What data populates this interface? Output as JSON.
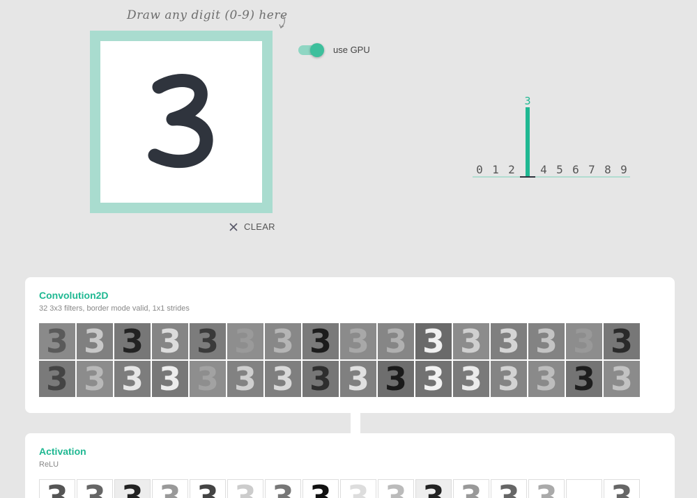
{
  "drawing": {
    "hint": "Draw any digit (0-9) here",
    "digit": "3",
    "clear_label": "CLEAR"
  },
  "gpu": {
    "label": "use GPU",
    "enabled": true
  },
  "output": {
    "labels": [
      "0",
      "1",
      "2",
      "3",
      "4",
      "5",
      "6",
      "7",
      "8",
      "9"
    ],
    "probabilities": [
      0,
      0,
      0,
      1,
      0,
      0,
      0,
      0,
      0,
      0
    ],
    "predicted": "3",
    "accent": "#1fb892"
  },
  "layers": [
    {
      "title": "Convolution2D",
      "description": "32 3x3 filters, border mode valid, 1x1 strides",
      "maps": [
        {
          "bg": "#8a8a8a",
          "fg": "#5a5a5a"
        },
        {
          "bg": "#808080",
          "fg": "#c8c8c8"
        },
        {
          "bg": "#777",
          "fg": "#222"
        },
        {
          "bg": "#858585",
          "fg": "#dcdcdc"
        },
        {
          "bg": "#7c7c7c",
          "fg": "#3a3a3a"
        },
        {
          "bg": "#8e8e8e",
          "fg": "#9a9a9a"
        },
        {
          "bg": "#888",
          "fg": "#b5b5b5"
        },
        {
          "bg": "#7a7a7a",
          "fg": "#1c1c1c"
        },
        {
          "bg": "#8b8b8b",
          "fg": "#a8a8a8"
        },
        {
          "bg": "#868686",
          "fg": "#b0b0b0"
        },
        {
          "bg": "#6a6a6a",
          "fg": "#f0f0f0"
        },
        {
          "bg": "#8c8c8c",
          "fg": "#cfcfcf"
        },
        {
          "bg": "#7f7f7f",
          "fg": "#d5d5d5"
        },
        {
          "bg": "#838383",
          "fg": "#c4c4c4"
        },
        {
          "bg": "#8d8d8d",
          "fg": "#999"
        },
        {
          "bg": "#777",
          "fg": "#2a2a2a"
        },
        {
          "bg": "#7a7a7a",
          "fg": "#444"
        },
        {
          "bg": "#8c8c8c",
          "fg": "#b8b8b8"
        },
        {
          "bg": "#7d7d7d",
          "fg": "#e6e6e6"
        },
        {
          "bg": "#787878",
          "fg": "#ededed"
        },
        {
          "bg": "#8e8e8e",
          "fg": "#a2a2a2"
        },
        {
          "bg": "#828282",
          "fg": "#cfcfcf"
        },
        {
          "bg": "#7f7f7f",
          "fg": "#d9d9d9"
        },
        {
          "bg": "#767676",
          "fg": "#2e2e2e"
        },
        {
          "bg": "#808080",
          "fg": "#e0e0e0"
        },
        {
          "bg": "#6e6e6e",
          "fg": "#1a1a1a"
        },
        {
          "bg": "#727272",
          "fg": "#f2f2f2"
        },
        {
          "bg": "#7a7a7a",
          "fg": "#ebebeb"
        },
        {
          "bg": "#848484",
          "fg": "#d2d2d2"
        },
        {
          "bg": "#8a8a8a",
          "fg": "#bdbdbd"
        },
        {
          "bg": "#747474",
          "fg": "#1e1e1e"
        },
        {
          "bg": "#8b8b8b",
          "fg": "#c2c2c2"
        }
      ]
    },
    {
      "title": "Activation",
      "description": "ReLU",
      "maps": [
        {
          "bg": "#ffffff",
          "fg": "#555"
        },
        {
          "bg": "#ffffff",
          "fg": "#666"
        },
        {
          "bg": "#ededed",
          "fg": "#222"
        },
        {
          "bg": "#ffffff",
          "fg": "#999"
        },
        {
          "bg": "#ffffff",
          "fg": "#444"
        },
        {
          "bg": "#ffffff",
          "fg": "#ccc"
        },
        {
          "bg": "#ffffff",
          "fg": "#777"
        },
        {
          "bg": "#ffffff",
          "fg": "#111"
        },
        {
          "bg": "#ffffff",
          "fg": "#ddd"
        },
        {
          "bg": "#ffffff",
          "fg": "#bbb"
        },
        {
          "bg": "#eeeeee",
          "fg": "#222"
        },
        {
          "bg": "#ffffff",
          "fg": "#999"
        },
        {
          "bg": "#ffffff",
          "fg": "#666"
        },
        {
          "bg": "#ffffff",
          "fg": "#aaa"
        },
        {
          "bg": "#ffffff",
          "fg": "#ffffff"
        },
        {
          "bg": "#ffffff",
          "fg": "#666"
        }
      ]
    }
  ]
}
